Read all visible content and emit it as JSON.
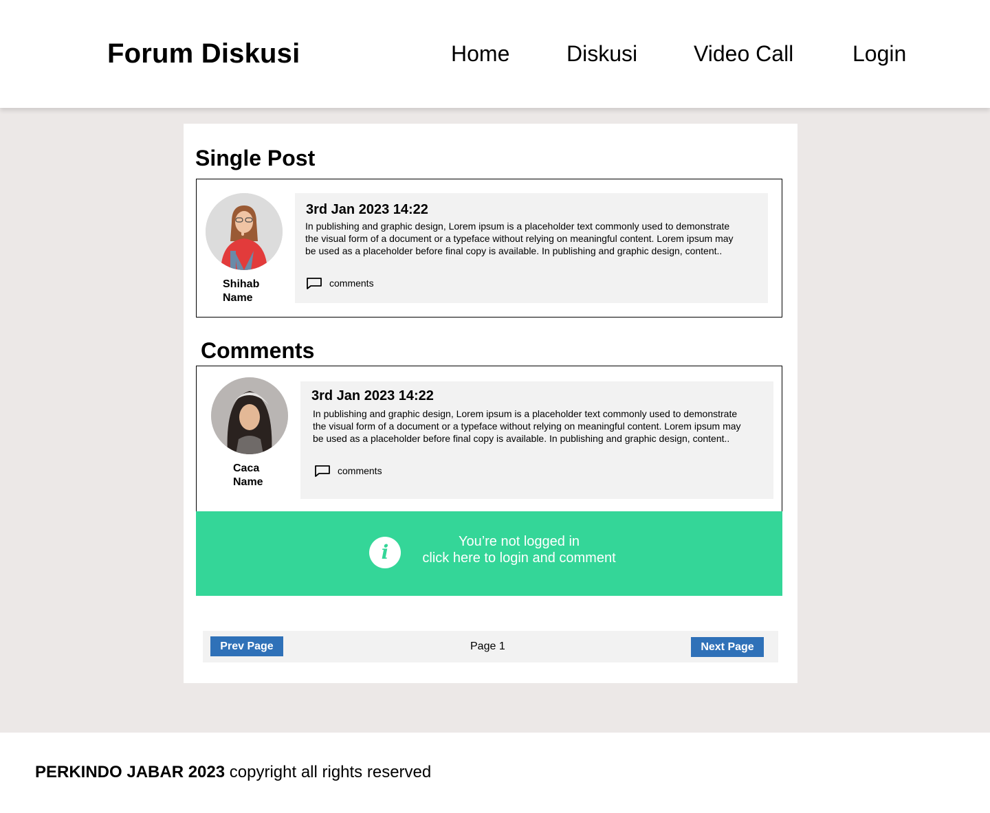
{
  "header": {
    "brand": "Forum Diskusi",
    "nav": [
      "Home",
      "Diskusi",
      "Video Call",
      "Login"
    ]
  },
  "single_post": {
    "heading": "Single Post",
    "author_first": "Shihab",
    "author_last": "Name",
    "date": "3rd Jan 2023  14:22",
    "body": "In publishing and graphic design, Lorem ipsum is a placeholder text commonly used to demonstrate the visual form of a document or a typeface without relying on meaningful content. Lorem ipsum may be used as a placeholder before final copy is available. In publishing and graphic design,  content..",
    "comments_label": "comments"
  },
  "comments": {
    "heading": "Comments",
    "items": [
      {
        "author_first": "Caca",
        "author_last": "Name",
        "date": "3rd Jan 2023  14:22",
        "body": "In publishing and graphic design, Lorem ipsum is a placeholder text commonly used to demonstrate the visual form of a document or a typeface without relying on meaningful content. Lorem ipsum may be used as a placeholder before final copy is available. In publishing and graphic design,  content..",
        "comments_label": "comments"
      }
    ]
  },
  "login_banner": {
    "line1": "You’re not logged in",
    "line2": "click here to login and comment",
    "icon": "info-icon",
    "color": "#34d698"
  },
  "pagination": {
    "prev": "Prev Page",
    "page": "Page 1",
    "next": "Next Page",
    "button_color": "#2f71b8"
  },
  "footer": {
    "org": "PERKINDO JABAR 2023",
    "text": " copyright all rights reserved"
  }
}
